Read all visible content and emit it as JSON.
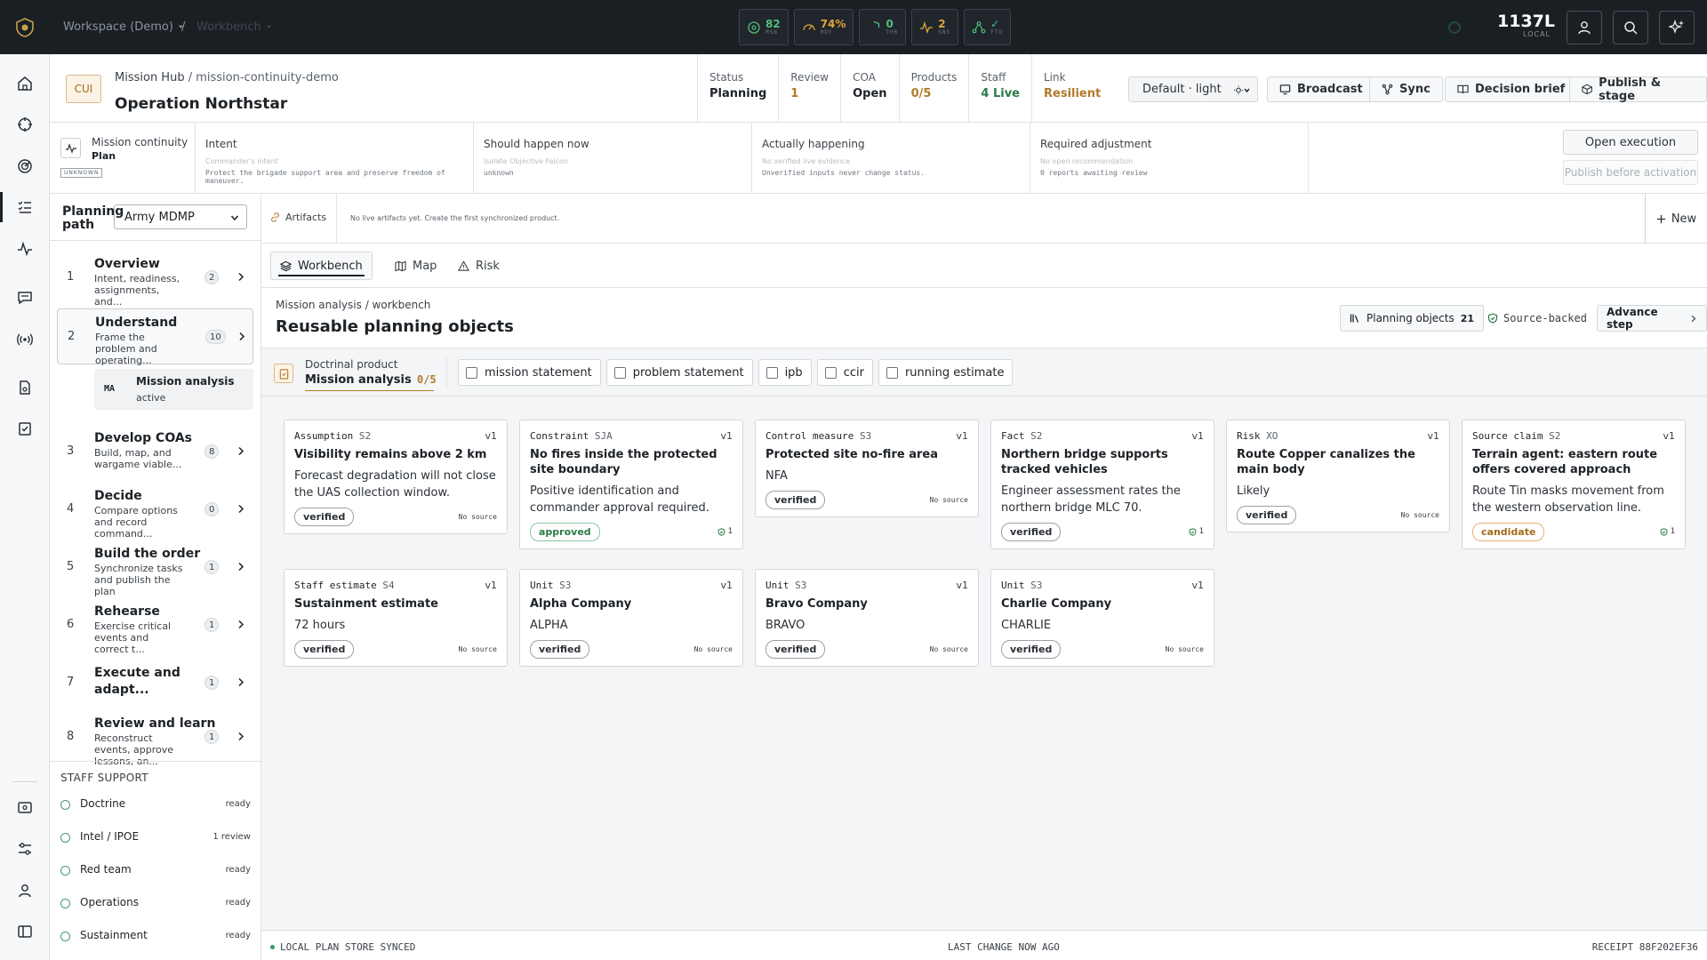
{
  "topbar": {
    "workspace": "Workspace (Demo)",
    "separator": "/",
    "role": "Workbench",
    "metrics": [
      {
        "value": "82",
        "label": "MSN",
        "color": "#4fbf7a"
      },
      {
        "value": "74%",
        "label": "RDY",
        "color": "#e0a53a"
      },
      {
        "value": "0",
        "label": "THR",
        "color": "#4fbf7a"
      },
      {
        "value": "2",
        "label": "SNS",
        "color": "#e0a53a"
      },
      {
        "value": "✓",
        "label": "FTO",
        "color": "#4fbf7a"
      }
    ],
    "clock_time": "1137L",
    "clock_zone": "LOCAL"
  },
  "header": {
    "classification": "CUI",
    "breadcrumb_root": "Mission Hub",
    "breadcrumb_sub": "/ mission-continuity-demo",
    "title": "Operation Northstar",
    "stats": [
      {
        "label": "Status",
        "value": "Planning",
        "color": "#1d2227"
      },
      {
        "label": "Review",
        "value": "1",
        "color": "#b07a2a"
      },
      {
        "label": "COA",
        "value": "Open",
        "color": "#1d2227"
      },
      {
        "label": "Products",
        "value": "0/5",
        "color": "#b07a2a"
      },
      {
        "label": "Staff",
        "value": "4 Live",
        "color": "#2b7a48"
      },
      {
        "label": "Link",
        "value": "Resilient",
        "color": "#b07a2a"
      }
    ],
    "theme_select": "Default · light",
    "buttons": {
      "broadcast": "Broadcast",
      "sync": "Sync",
      "decision_brief": "Decision brief",
      "publish_stage": "Publish & stage"
    }
  },
  "continuity": {
    "title": "Mission continuity",
    "mode": "Plan",
    "state_tag": "UNKNOWN",
    "segments": [
      {
        "heading": "Intent",
        "line1": "Commander's intent",
        "line2": "Protect the brigade support area and preserve freedom of maneuver."
      },
      {
        "heading": "Should happen now",
        "line1": "Isolate Objective Falcon",
        "line2": "unknown"
      },
      {
        "heading": "Actually happening",
        "line1": "No verified live evidence",
        "line2": "Unverified inputs never change status."
      },
      {
        "heading": "Required adjustment",
        "line1": "No open recommendation",
        "line2": "0 reports awaiting review"
      }
    ],
    "open_execution": "Open execution",
    "publish_before": "Publish before activation"
  },
  "planning": {
    "label": "Planning path",
    "method": "Army MDMP",
    "steps": [
      {
        "num": "1",
        "title": "Overview",
        "desc": "Intent, readiness, assignments, and...",
        "count": "2"
      },
      {
        "num": "2",
        "title": "Understand",
        "desc": "Frame the problem and operating...",
        "count": "10"
      },
      {
        "num": "3",
        "title": "Develop COAs",
        "desc": "Build, map, and wargame viable...",
        "count": "8"
      },
      {
        "num": "4",
        "title": "Decide",
        "desc": "Compare options and record command...",
        "count": "0"
      },
      {
        "num": "5",
        "title": "Build the order",
        "desc": "Synchronize tasks and publish the plan",
        "count": "1"
      },
      {
        "num": "6",
        "title": "Rehearse",
        "desc": "Exercise critical events and correct t...",
        "count": "1"
      },
      {
        "num": "7",
        "title": "Execute and adapt...",
        "desc": "",
        "count": "1"
      },
      {
        "num": "8",
        "title": "Review and learn",
        "desc": "Reconstruct events, approve lessons, an...",
        "count": "1"
      }
    ],
    "substep": {
      "abbr": "MA",
      "title": "Mission analysis",
      "status": "active"
    },
    "staff_support_label": "STAFF SUPPORT",
    "staff": [
      {
        "name": "Doctrine",
        "status": "ready"
      },
      {
        "name": "Intel / IPOE",
        "status": "1 review"
      },
      {
        "name": "Red team",
        "status": "ready"
      },
      {
        "name": "Operations",
        "status": "ready"
      },
      {
        "name": "Sustainment",
        "status": "ready"
      }
    ]
  },
  "artifacts": {
    "label": "Artifacts",
    "empty": "No live artifacts yet. Create the first synchronized product.",
    "new_label": "New"
  },
  "tabs": [
    {
      "label": "Workbench"
    },
    {
      "label": "Map"
    },
    {
      "label": "Risk"
    }
  ],
  "workbench": {
    "breadcrumb": "Mission analysis / workbench",
    "title": "Reusable planning objects",
    "planning_objects_label": "Planning objects",
    "planning_objects_count": "21",
    "source_backed": "Source-backed",
    "advance_step": "Advance step"
  },
  "doctrinal": {
    "label": "Doctrinal product",
    "product": "Mission analysis",
    "progress": "0/5",
    "chips": [
      "mission statement",
      "problem statement",
      "ipb",
      "ccir",
      "running estimate"
    ]
  },
  "cards": [
    {
      "kind": "Assumption",
      "code": "S2",
      "version": "v1",
      "title": "Visibility remains above 2 km",
      "desc": "Forecast degradation will not close the UAS collection window.",
      "status": "verified",
      "source": "No source"
    },
    {
      "kind": "Constraint",
      "code": "SJA",
      "version": "v1",
      "title": "No fires inside the protected site boundary",
      "desc": "Positive identification and commander approval required.",
      "status": "approved",
      "source": "1"
    },
    {
      "kind": "Control measure",
      "code": "S3",
      "version": "v1",
      "title": "Protected site no-fire area",
      "desc": "NFA",
      "status": "verified",
      "source": "No source"
    },
    {
      "kind": "Fact",
      "code": "S2",
      "version": "v1",
      "title": "Northern bridge supports tracked vehicles",
      "desc": "Engineer assessment rates the northern bridge MLC 70.",
      "status": "verified",
      "source": "1"
    },
    {
      "kind": "Risk",
      "code": "XO",
      "version": "v1",
      "title": "Route Copper canalizes the main body",
      "desc": "Likely",
      "status": "verified",
      "source": "No source"
    },
    {
      "kind": "Source claim",
      "code": "S2",
      "version": "v1",
      "title": "Terrain agent: eastern route offers covered approach",
      "desc": "Route Tin masks movement from the western observation line.",
      "status": "candidate",
      "source": "1"
    },
    {
      "kind": "Staff estimate",
      "code": "S4",
      "version": "v1",
      "title": "Sustainment estimate",
      "desc": "72 hours",
      "status": "verified",
      "source": "No source"
    },
    {
      "kind": "Unit",
      "code": "S3",
      "version": "v1",
      "title": "Alpha Company",
      "desc": "ALPHA",
      "status": "verified",
      "source": "No source"
    },
    {
      "kind": "Unit",
      "code": "S3",
      "version": "v1",
      "title": "Bravo Company",
      "desc": "BRAVO",
      "status": "verified",
      "source": "No source"
    },
    {
      "kind": "Unit",
      "code": "S3",
      "version": "v1",
      "title": "Charlie Company",
      "desc": "CHARLIE",
      "status": "verified",
      "source": "No source"
    }
  ],
  "footer": {
    "left": "LOCAL PLAN STORE SYNCED",
    "middle": "LAST CHANGE NOW AGO",
    "right": "RECEIPT 88F202EF36"
  }
}
